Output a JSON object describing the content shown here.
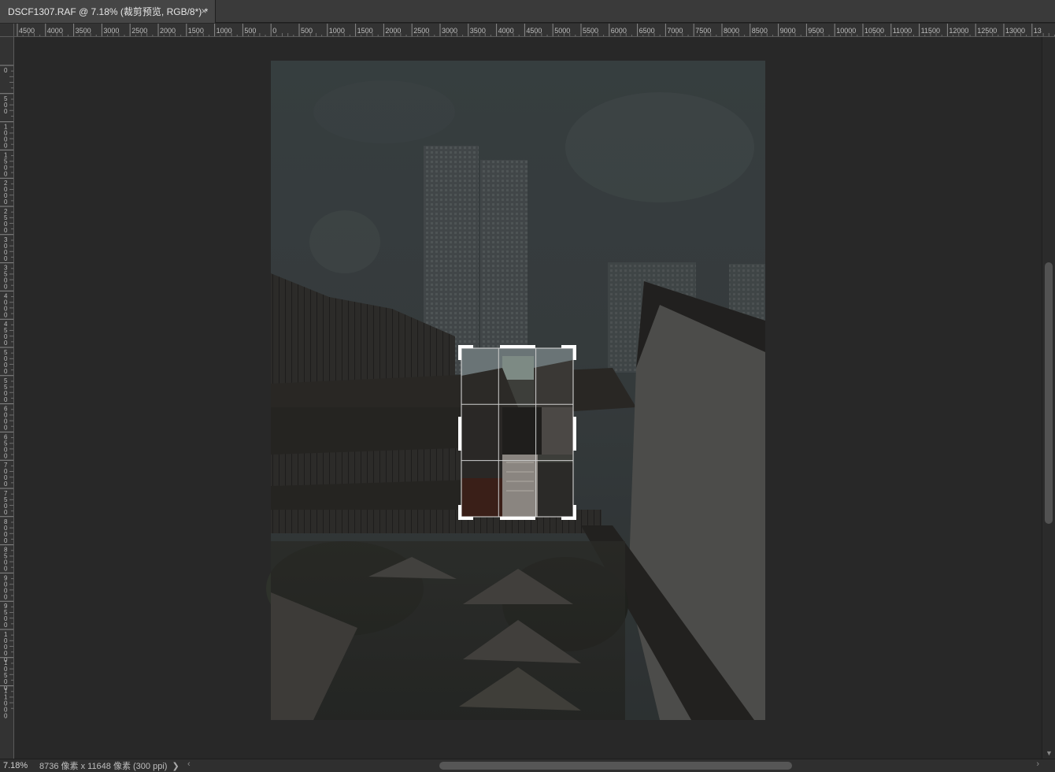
{
  "tab": {
    "title": "DSCF1307.RAF @ 7.18% (裁剪预览, RGB/8*) *",
    "close": "×"
  },
  "rulers": {
    "horizontal_labels": [
      "4500",
      "4000",
      "3500",
      "3000",
      "2500",
      "2000",
      "1500",
      "1000",
      "500",
      "0",
      "500",
      "1000",
      "1500",
      "2000",
      "2500",
      "3000",
      "3500",
      "4000",
      "4500",
      "5000",
      "5500",
      "6000",
      "6500",
      "7000",
      "7500",
      "8000",
      "8500",
      "9000",
      "9500",
      "10000",
      "10500",
      "11000",
      "11500",
      "12000",
      "12500",
      "13000",
      "13"
    ],
    "vertical_labels": [
      "0",
      "500",
      "1000",
      "1500",
      "2000",
      "2500",
      "3000",
      "3500",
      "4000",
      "4500",
      "5000",
      "5500",
      "6000",
      "6500",
      "7000",
      "7500",
      "8000",
      "8500",
      "9000",
      "9500",
      "10000",
      "10500",
      "11000"
    ]
  },
  "status": {
    "zoom": "7.18%",
    "doc_info": "8736 像素 x 11648 像素 (300 ppi)",
    "arrow": "❯",
    "scroll_left": "‹",
    "scroll_right": "›"
  },
  "crop": {
    "grid": "rule-of-thirds"
  },
  "colors": {
    "accent": "#ffffff",
    "canvas_bg": "#282828",
    "panel_bg": "#333333"
  }
}
